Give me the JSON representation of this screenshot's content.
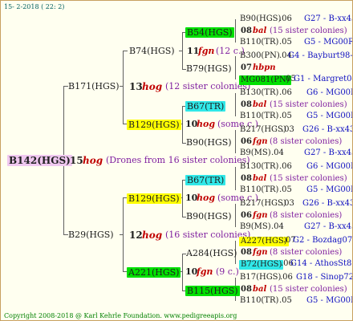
{
  "header": "15-  2-2018 ( 22:  2)",
  "footer": "Copyright 2008-2018 @ Karl Kehrle Foundation.   www.pedigreeapis.org",
  "root": {
    "id": "B142(HGS)",
    "gen": "15",
    "gen_mark": "hog",
    "note": "(Drones from 16 sister colonies)"
  },
  "g1": [
    {
      "id": "B171(HGS)"
    },
    {
      "id": "B29(HGS)",
      "gen": "12",
      "gen_mark": "hog",
      "note": "(16 sister colonies)"
    }
  ],
  "g2": [
    {
      "id": "B74(HGS)",
      "gen": "11",
      "gen_mark": "fgn",
      "note": "(12 c.)"
    },
    {
      "id": "B129(HGS)",
      "gen": "10",
      "gen_mark": "hog",
      "note": "(some c.)"
    },
    {
      "id": "B129(HGS)",
      "gen": "10",
      "gen_mark": "hog",
      "note": "(some c.)"
    },
    {
      "id": "A221(HGS)",
      "gen": "10",
      "gen_mark": "fgn",
      "note": "(9 c.)"
    }
  ],
  "g1_mid": {
    "gen": "13",
    "gen_mark": "hog",
    "note": "(12 sister colonies)"
  },
  "g3": [
    {
      "id": "B54(HGS)",
      "gen": "08",
      "gen_mark": "bal",
      "note": "(15 sister colonies)"
    },
    {
      "id": "B79(HGS)",
      "gen": "07",
      "gen_mark": "hbpn"
    },
    {
      "id": "B67(TR)",
      "gen": "08",
      "gen_mark": "bal",
      "note": "(15 sister colonies)"
    },
    {
      "id": "B90(HGS)",
      "gen": "06",
      "gen_mark": "fgn",
      "note": "(8 sister colonies)"
    },
    {
      "id": "B67(TR)",
      "gen": "08",
      "gen_mark": "bal",
      "note": "(15 sister colonies)"
    },
    {
      "id": "B90(HGS)",
      "gen": "06",
      "gen_mark": "fgn",
      "note": "(8 sister colonies)"
    },
    {
      "id": "A284(HGS)",
      "gen": "08",
      "gen_mark": "fgn",
      "note": "(8 sister colonies)"
    },
    {
      "id": "B115(HGS)",
      "gen": "08",
      "gen_mark": "bal",
      "note": "(15 sister colonies)"
    }
  ],
  "g4": [
    {
      "id": "B90(HGS)",
      "num": ".06",
      "loc": "G27 - B-xx43"
    },
    {
      "id": "B110(TR)",
      "num": ".05",
      "loc": "G5 - MG00R"
    },
    {
      "id": "B300(PN)",
      "num": ".04",
      "loc": "G4 - Bayburt98-3"
    },
    {
      "id": "MG081(PN)",
      "num": ".05",
      "loc": "G1 - Margret04R"
    },
    {
      "id": "B130(TR)",
      "num": ".06",
      "loc": "G6 - MG00R"
    },
    {
      "id": "B110(TR)",
      "num": ".05",
      "loc": "G5 - MG00R"
    },
    {
      "id": "B217(HGS)",
      "num": ".03",
      "loc": "G26 - B-xx43"
    },
    {
      "id": "B9(MS)",
      "num": ".04",
      "loc": "G27 - B-xx43"
    },
    {
      "id": "B130(TR)",
      "num": ".06",
      "loc": "G6 - MG00R"
    },
    {
      "id": "B110(TR)",
      "num": ".05",
      "loc": "G5 - MG00R"
    },
    {
      "id": "B217(HGS)",
      "num": ".03",
      "loc": "G26 - B-xx43"
    },
    {
      "id": "B9(MS)",
      "num": ".04",
      "loc": "G27 - B-xx43"
    },
    {
      "id": "A227(HGS)",
      "num": ".07",
      "loc": "G2 - Bozdag07R"
    },
    {
      "id": "B72(HGS)",
      "num": ".06",
      "loc": "G14 - AthosSt80R"
    },
    {
      "id": "B17(HGS)",
      "num": ".06",
      "loc": "G18 - Sinop72R"
    },
    {
      "id": "B110(TR)",
      "num": ".05",
      "loc": "G5 - MG00R"
    }
  ]
}
